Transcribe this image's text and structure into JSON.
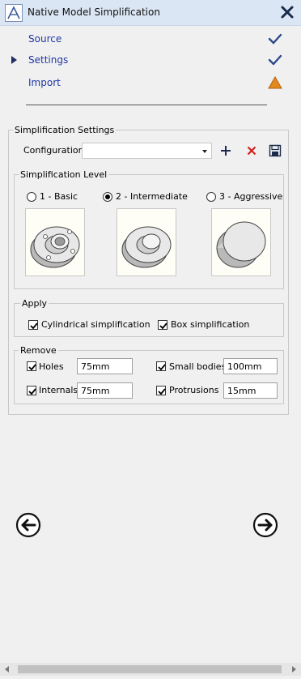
{
  "window": {
    "title": "Native Model Simplification",
    "close_icon": "close-icon"
  },
  "nav": {
    "items": [
      {
        "label": "Source",
        "status": "complete",
        "status_icon": "check-icon"
      },
      {
        "label": "Settings",
        "status": "complete",
        "status_icon": "check-icon",
        "current": true
      },
      {
        "label": "Import",
        "status": "warning",
        "status_icon": "warning-icon"
      }
    ]
  },
  "simplification_settings": {
    "title": "Simplification Settings",
    "configuration": {
      "label": "Configuration",
      "value": ""
    },
    "toolbar": {
      "add_icon": "plus-icon",
      "delete_icon": "delete-icon",
      "save_icon": "save-icon"
    },
    "level": {
      "title": "Simplification Level",
      "options": [
        {
          "label": "1 - Basic",
          "selected": false,
          "preview": "flange-with-holes"
        },
        {
          "label": "2 - Intermediate",
          "selected": true,
          "preview": "flange-no-holes"
        },
        {
          "label": "3 - Aggressive",
          "selected": false,
          "preview": "solid-disc"
        }
      ]
    },
    "apply": {
      "title": "Apply",
      "cylindrical": {
        "label": "Cylindrical simplification",
        "checked": true
      },
      "box": {
        "label": "Box simplification",
        "checked": true
      }
    },
    "remove": {
      "title": "Remove",
      "holes": {
        "label": "Holes",
        "checked": true,
        "value": "75mm"
      },
      "small_bodies": {
        "label": "Small bodies",
        "checked": true,
        "value": "100mm"
      },
      "internals": {
        "label": "Internals",
        "checked": true,
        "value": "75mm"
      },
      "protrusions": {
        "label": "Protrusions",
        "checked": true,
        "value": "15mm"
      }
    }
  },
  "footer": {
    "back_icon": "arrow-left-icon",
    "next_icon": "arrow-right-icon"
  },
  "colors": {
    "title_bar": "#dbe6f4",
    "link": "#1f37a6",
    "check": "#2c4a8a",
    "warning": "#e48a1c"
  }
}
